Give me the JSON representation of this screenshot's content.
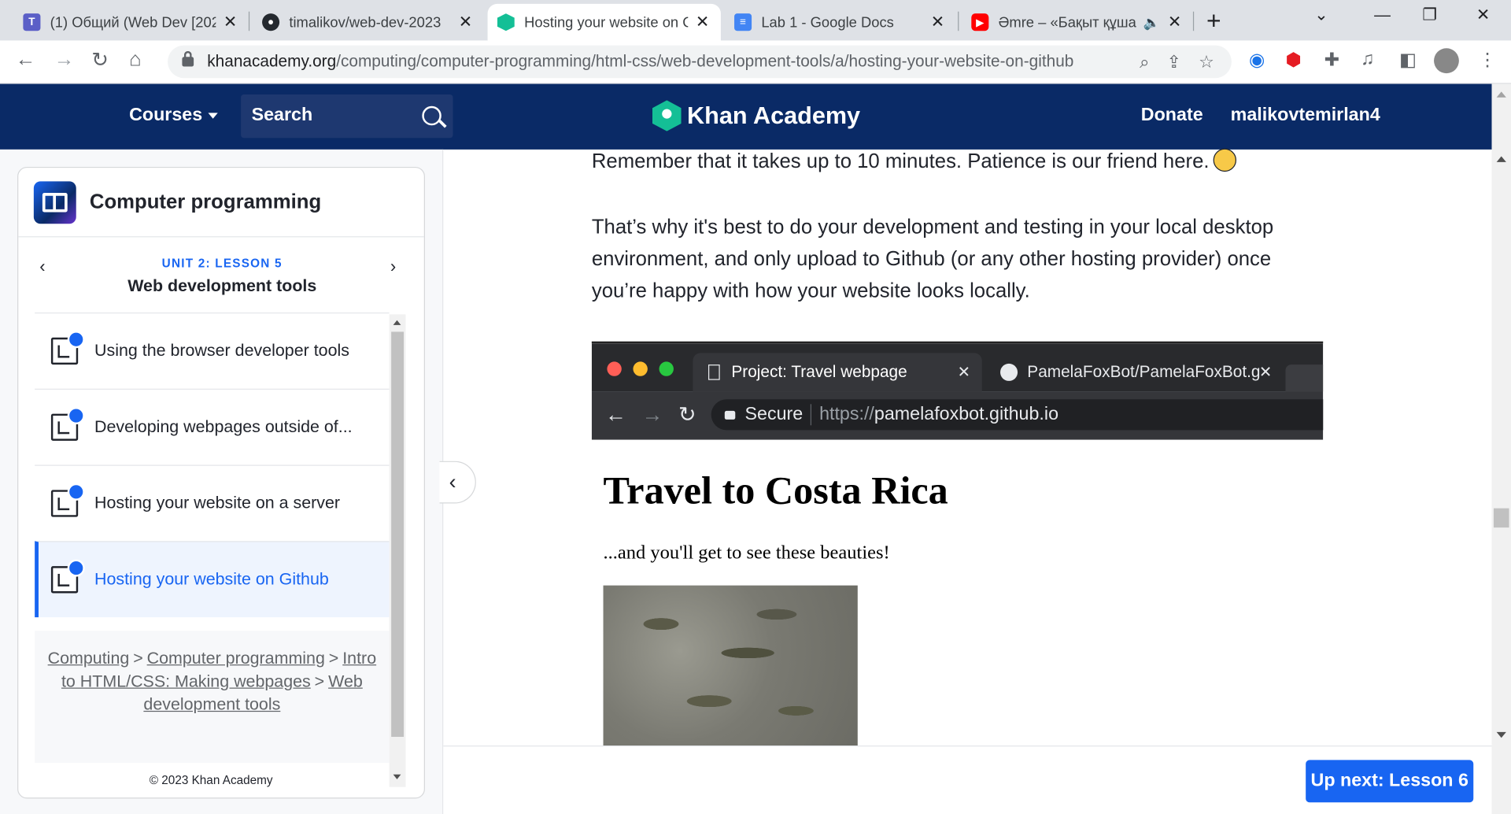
{
  "browser": {
    "tabs": [
      {
        "title": "(1) Общий (Web Dev [202",
        "favicon": "teams-icon"
      },
      {
        "title": "timalikov/web-dev-2023",
        "favicon": "github-icon"
      },
      {
        "title": "Hosting your website on G",
        "favicon": "khan-academy-icon",
        "active": true
      },
      {
        "title": "Lab 1 - Google Docs",
        "favicon": "google-docs-icon"
      },
      {
        "title": "Әmre – «Бақыт құша",
        "favicon": "youtube-icon",
        "audio": true
      }
    ],
    "url_host": "khanacademy.org",
    "url_path": "/computing/computer-programming/html-css/web-development-tools/a/hosting-your-website-on-github"
  },
  "header": {
    "courses_label": "Courses",
    "search_label": "Search",
    "logo_text": "Khan Academy",
    "donate_label": "Donate",
    "username": "malikovtemirlan4"
  },
  "sidebar": {
    "course_title": "Computer programming",
    "unit_subtitle": "UNIT 2: LESSON 5",
    "unit_title": "Web development tools",
    "lessons": [
      {
        "label": "Using the browser developer tools"
      },
      {
        "label": "Developing webpages outside of..."
      },
      {
        "label": "Hosting your website on a server"
      },
      {
        "label": "Hosting your website on Github",
        "active": true
      }
    ],
    "breadcrumbs": [
      "Computing",
      "Computer programming",
      "Intro to HTML/CSS: Making webpages",
      "Web development tools"
    ],
    "breadcrumb_separator": ">",
    "copyright": "© 2023 Khan Academy"
  },
  "article": {
    "paragraph1": "Remember that it takes up to 10 minutes. Patience is our friend here.",
    "paragraph2": "That’s why it's best to do your development and testing in your local desktop environment, and only upload to Github (or any other hosting provider) once you’re happy with how your website looks locally."
  },
  "screenshot": {
    "tab1_title": "Project: Travel webpage",
    "tab2_title": "PamelaFoxBot/PamelaFoxBot.g",
    "secure_label": "Secure",
    "url_scheme": "https://",
    "url_host": "pamelafoxbot.github.io",
    "heading": "Travel to Costa Rica",
    "subtext": "...and you'll get to see these beauties!"
  },
  "footer": {
    "up_next_label": "Up next: Lesson 6"
  },
  "colors": {
    "ka_navy": "#0a2a66",
    "ka_blue": "#1865f2",
    "ka_green": "#14bf96"
  }
}
